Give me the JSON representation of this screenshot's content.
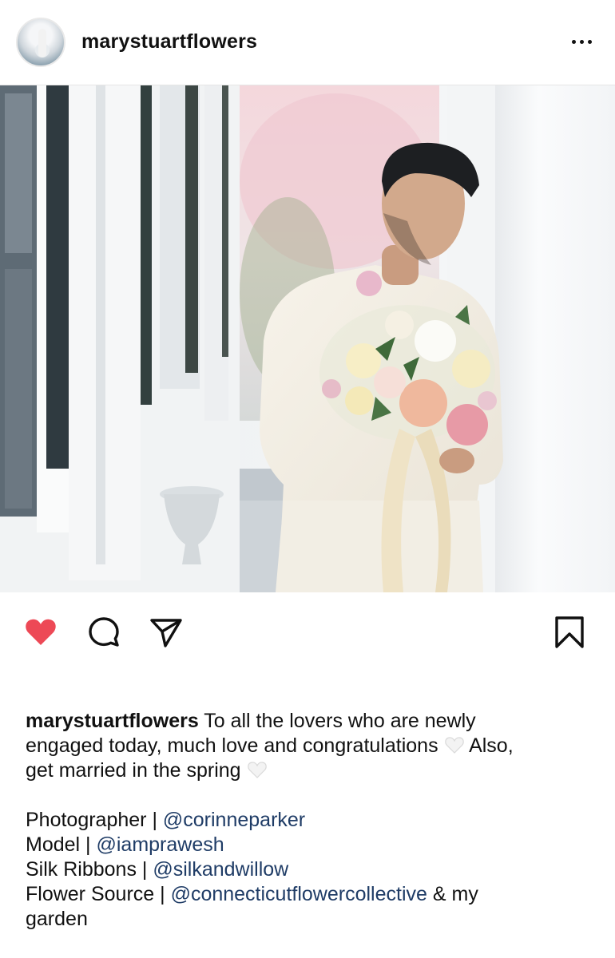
{
  "post": {
    "username": "marystuartflowers",
    "liked": true
  },
  "caption": {
    "username": "marystuartflowers",
    "line1": " To all the lovers who are newly",
    "line2a": "engaged today, much love and congratulations ",
    "line2b": " Also,",
    "line3": "get married in the spring ",
    "credits": [
      {
        "label": "Photographer | ",
        "handle": "@corinneparker",
        "suffix": ""
      },
      {
        "label": "Model | ",
        "handle": "@iamprawesh",
        "suffix": ""
      },
      {
        "label": "Silk Ribbons | ",
        "handle": "@silkandwillow",
        "suffix": ""
      },
      {
        "label": "Flower Source | ",
        "handle": "@connecticutflowercollective",
        "suffix": " & my"
      }
    ],
    "last_line": "garden"
  },
  "icons": {
    "more": "more-horizontal-icon",
    "like": "heart-filled-icon",
    "comment": "comment-bubble-icon",
    "share": "paper-plane-icon",
    "save": "bookmark-icon",
    "emoji": "white-heart-emoji"
  },
  "colors": {
    "like_red": "#ed4956",
    "link_blue": "#1f3c66"
  }
}
